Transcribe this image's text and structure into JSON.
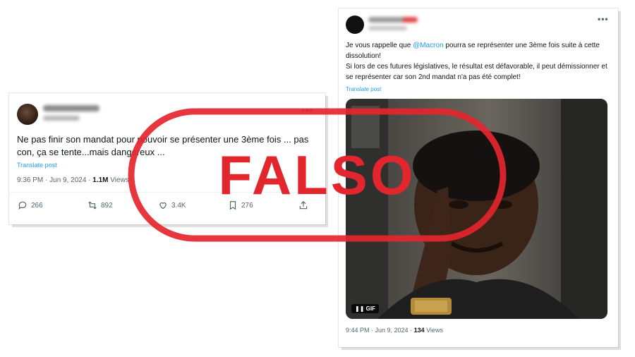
{
  "tweet_left": {
    "text": "Ne pas finir son mandat pour pouvoir se présenter une 3ème fois ... pas con, ça se tente...mais dangereux ...",
    "translate_label": "Translate post",
    "time": "9:36 PM · Jun 9, 2024 · ",
    "views_count": "1.1M",
    "views_label": " Views",
    "replies": "266",
    "reposts": "892",
    "likes": "3.4K",
    "bookmarks": "276"
  },
  "tweet_right": {
    "text_before_mention": "Je vous rappelle que ",
    "mention": "@Macron",
    "text_after_mention": " pourra se représenter une 3ème fois suite à cette dissolution!",
    "text_line2": "Si lors de ces futures législatives, le résultat est défavorable, il peut démissionner et se représenter car son 2nd mandat n'a pas été complet!",
    "translate_label": "Translate post",
    "media_badge": "GIF",
    "time": "9:44 PM · Jun 9, 2024 · ",
    "views_count": "134",
    "views_label": " Views"
  },
  "stamp": {
    "label": "FALSO",
    "color": "#e3262d"
  },
  "colors": {
    "link": "#1d9bf0",
    "muted": "#536471",
    "text": "#0f1419"
  }
}
